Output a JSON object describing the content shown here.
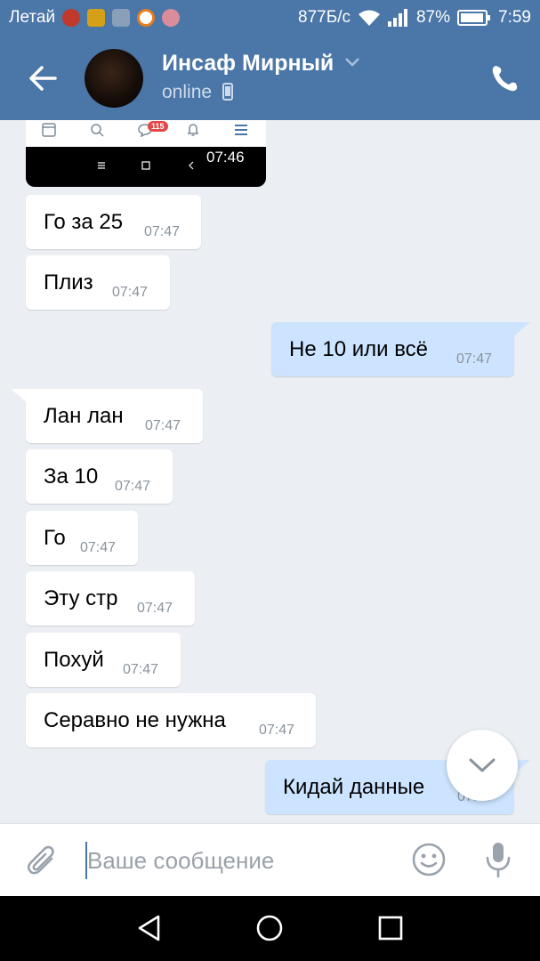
{
  "status_bar": {
    "carrier": "Летай",
    "speed": "877Б/с",
    "battery": "87%",
    "time": "7:59"
  },
  "header": {
    "contact_name": "Инсаф Мирный",
    "status": "online",
    "icons": [
      "back-arrow-icon",
      "chevron-down-icon",
      "mobile-icon",
      "phone-icon"
    ]
  },
  "screenshot_attachment": {
    "badge": "115",
    "time": "07:46"
  },
  "messages": [
    {
      "text": "Го за 25",
      "time": "07:47",
      "dir": "in"
    },
    {
      "text": "Плиз",
      "time": "07:47",
      "dir": "in"
    },
    {
      "text": "Не 10 или всё",
      "time": "07:47",
      "dir": "out"
    },
    {
      "text": "Лан лан",
      "time": "07:47",
      "dir": "in"
    },
    {
      "text": "За 10",
      "time": "07:47",
      "dir": "in"
    },
    {
      "text": "Го",
      "time": "07:47",
      "dir": "in"
    },
    {
      "text": "Эту стр",
      "time": "07:47",
      "dir": "in"
    },
    {
      "text": "Похуй",
      "time": "07:47",
      "dir": "in"
    },
    {
      "text": "Серавно не нужна",
      "time": "07:47",
      "dir": "in"
    },
    {
      "text": "Кидай данные",
      "time": "07:47",
      "dir": "out"
    }
  ],
  "composer": {
    "placeholder": "Ваше сообщение"
  },
  "colors": {
    "accent": "#4a76a8",
    "outgoing_bubble": "#cce4ff",
    "incoming_bubble": "#ffffff",
    "background": "#ebeef2"
  }
}
